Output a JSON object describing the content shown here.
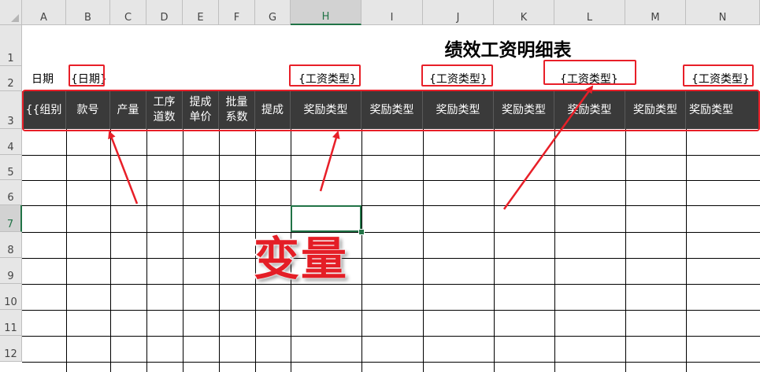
{
  "columns": [
    "A",
    "B",
    "C",
    "D",
    "E",
    "F",
    "G",
    "H",
    "I",
    "J",
    "K",
    "L",
    "M",
    "N"
  ],
  "selected_column": "H",
  "rows": [
    "1",
    "2",
    "3",
    "4",
    "5",
    "6",
    "7",
    "8",
    "9",
    "10",
    "11",
    "12"
  ],
  "selected_row": "7",
  "sheet_title": "绩效工资明细表",
  "date_label": "日期",
  "date_placeholder": "{日期}",
  "wage_type_placeholders": [
    "{工资类型}",
    "{工资类型}",
    "{工资类型}",
    "{工资类型}"
  ],
  "header_cells": [
    "{{组别",
    "款号",
    "产量",
    "工序\n道数",
    "提成\n单价",
    "批量\n系数",
    "提成",
    "奖励类型",
    "奖励类型",
    "奖励类型",
    "奖励类型",
    "奖励类型",
    "奖励类型",
    "奖励类型"
  ],
  "annotation_text": "变量",
  "colors": {
    "accent_red": "#e81f28",
    "header_band": "#3a3a3a",
    "excel_green": "#217346"
  }
}
